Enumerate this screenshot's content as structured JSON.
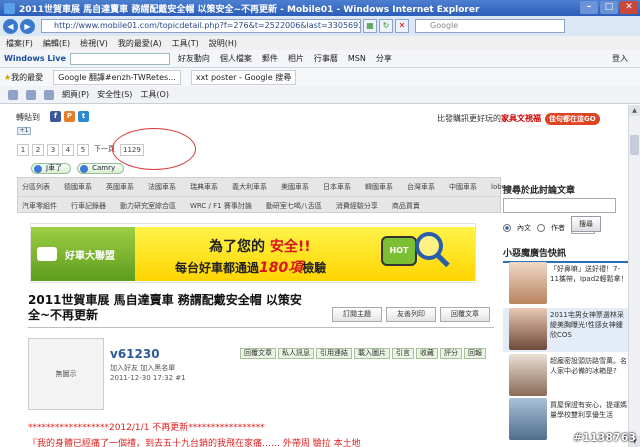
{
  "window": {
    "title": "2011世賀車展 馬自達賣車 務謂配戴安全帽 以策安全~不再更新 - Mobile01 - Windows Internet Explorer",
    "url": "http://www.mobile01.com/topicdetail.php?f=276&t=2522006&last=33056936",
    "search_placeholder": "Google"
  },
  "menu": [
    "檔案(F)",
    "編輯(E)",
    "檢視(V)",
    "我的最愛(A)",
    "工具(T)",
    "說明(H)"
  ],
  "live_toolbar": {
    "brand": "Windows Live",
    "items": [
      "好友動向",
      "個人檔案",
      "郵件",
      "相片",
      "行事曆",
      "MSN",
      "分享"
    ],
    "login": "登入"
  },
  "favorites_bar": {
    "label": "我的最愛",
    "tabs": [
      "Google 翻譯#enzh-TWRetes...",
      "xxt poster - Google 搜尋"
    ]
  },
  "command_bar": [
    "網頁(P)",
    "安全性(S)",
    "工具(O)"
  ],
  "share": {
    "label": "轉貼到"
  },
  "top_ad": {
    "text": "比發購訊更好玩的",
    "highlight": "家具文視福",
    "button": "佳句都在這GO"
  },
  "pager": {
    "pages": [
      "1",
      "2",
      "3",
      "4",
      "5"
    ],
    "next": "下一頁",
    "last": "1129"
  },
  "bookmark_buttons": [
    "J車了",
    "Camry"
  ],
  "categories": {
    "row1": [
      "分區列表",
      "德國車系",
      "英國車系",
      "法國車系",
      "瑞典車系",
      "義大利車系",
      "美國車系",
      "日本車系",
      "韓國車系",
      "台灣車系",
      "中國車系",
      "lobe"
    ],
    "row2": [
      "汽車零組件",
      "行車記錄器",
      "動力研究室綜合區",
      "WRC / F1 賽事討論",
      "動研室七喝八舌區",
      "消費經驗分享",
      "商品買賣"
    ]
  },
  "banner": {
    "logo_text": "好車大聯盟",
    "line1_prefix": "為了您的",
    "line1_highlight": "安全!!",
    "line2_prefix": "每台好車都通過",
    "line2_number": "180項",
    "line2_suffix": "檢驗",
    "badge": "HOT"
  },
  "post": {
    "title": "2011世賀車展 馬自達賣車 務謂配戴安全帽 以策安全~不再更新",
    "actions": [
      "訂閱主題",
      "友善列印",
      "回覆文章"
    ],
    "avatar_label": "無圖示",
    "username": "v61230",
    "user_links": "加入好友 加入黑名單",
    "date": "2011-12-30 17:32 #1",
    "tools": [
      "回覆文章",
      "私人訊息",
      "引用連結",
      "載入圖片",
      "引言",
      "收藏",
      "評分",
      "回報"
    ],
    "note_line1": "******************2012/1/1 不再更新*****************",
    "note_line2": "『我的身體已經痛了一個禮，到去五十九台銷的我飛在家痛……  外帶周 驗拉 本土地"
  },
  "sidebar": {
    "search_title": "搜尋於此討論文章",
    "radio_content": "內文",
    "radio_author": "作者",
    "search_button": "搜尋",
    "ad_title": "小惡魔廣告快訊",
    "ads": [
      {
        "text": "「好鼻嘛」送好禮！7-11攜帶，Ipad2輕鬆拿！"
      },
      {
        "text": "2011宅男女神票選林采緹美胸曝光!性感女神鍾欣COS"
      },
      {
        "text": "超龐密設頭訪路雪萬。名人家中必備的冰箱是?"
      },
      {
        "text": "買屋保證有安心，提運媽量學校雙利享優生活"
      }
    ]
  },
  "watermark": "#1138763"
}
